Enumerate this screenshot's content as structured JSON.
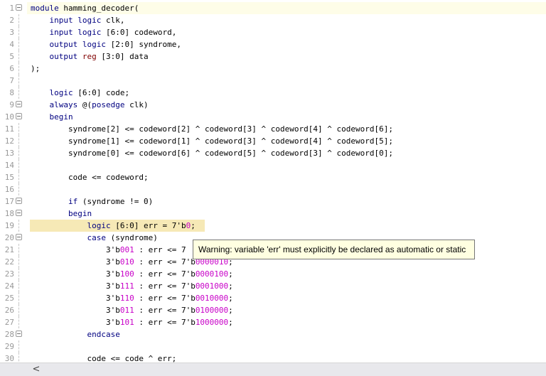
{
  "editor": {
    "lines": [
      {
        "n": "1",
        "fold": true,
        "tokens": [
          [
            "kw",
            "module"
          ],
          [
            "t",
            " hamming_decoder("
          ]
        ]
      },
      {
        "n": "2",
        "fold": false,
        "tokens": [
          [
            "t",
            "    "
          ],
          [
            "kw",
            "input"
          ],
          [
            "t",
            " "
          ],
          [
            "kw",
            "logic"
          ],
          [
            "t",
            " clk,"
          ]
        ]
      },
      {
        "n": "3",
        "fold": false,
        "tokens": [
          [
            "t",
            "    "
          ],
          [
            "kw",
            "input"
          ],
          [
            "t",
            " "
          ],
          [
            "kw",
            "logic"
          ],
          [
            "t",
            " [6:0] codeword,"
          ]
        ]
      },
      {
        "n": "4",
        "fold": false,
        "tokens": [
          [
            "t",
            "    "
          ],
          [
            "kw",
            "output"
          ],
          [
            "t",
            " "
          ],
          [
            "kw",
            "logic"
          ],
          [
            "t",
            " [2:0] syndrome,"
          ]
        ]
      },
      {
        "n": "5",
        "fold": false,
        "tokens": [
          [
            "t",
            "    "
          ],
          [
            "kw",
            "output"
          ],
          [
            "t",
            " "
          ],
          [
            "kw2",
            "reg"
          ],
          [
            "t",
            " [3:0] data"
          ]
        ]
      },
      {
        "n": "6",
        "fold": false,
        "tokens": [
          [
            "t",
            ");"
          ]
        ]
      },
      {
        "n": "7",
        "fold": false,
        "tokens": []
      },
      {
        "n": "8",
        "fold": false,
        "tokens": [
          [
            "t",
            "    "
          ],
          [
            "kw",
            "logic"
          ],
          [
            "t",
            " [6:0] code;"
          ]
        ]
      },
      {
        "n": "9",
        "fold": true,
        "tokens": [
          [
            "t",
            "    "
          ],
          [
            "kw",
            "always"
          ],
          [
            "t",
            " @("
          ],
          [
            "kw",
            "posedge"
          ],
          [
            "t",
            " clk)"
          ]
        ]
      },
      {
        "n": "10",
        "fold": true,
        "tokens": [
          [
            "t",
            "    "
          ],
          [
            "kw",
            "begin"
          ]
        ]
      },
      {
        "n": "11",
        "fold": false,
        "tokens": [
          [
            "t",
            "        syndrome[2] <= codeword[2] ^ codeword[3] ^ codeword[4] ^ codeword[6];"
          ]
        ]
      },
      {
        "n": "12",
        "fold": false,
        "tokens": [
          [
            "t",
            "        syndrome[1] <= codeword[1] ^ codeword[3] ^ codeword[4] ^ codeword[5];"
          ]
        ]
      },
      {
        "n": "13",
        "fold": false,
        "tokens": [
          [
            "t",
            "        syndrome[0] <= codeword[6] ^ codeword[5] ^ codeword[3] ^ codeword[0];"
          ]
        ]
      },
      {
        "n": "14",
        "fold": false,
        "tokens": []
      },
      {
        "n": "15",
        "fold": false,
        "tokens": [
          [
            "t",
            "        code <= codeword;"
          ]
        ]
      },
      {
        "n": "16",
        "fold": false,
        "tokens": []
      },
      {
        "n": "17",
        "fold": true,
        "tokens": [
          [
            "t",
            "        "
          ],
          [
            "kw",
            "if"
          ],
          [
            "t",
            " (syndrome != 0)"
          ]
        ]
      },
      {
        "n": "18",
        "fold": true,
        "tokens": [
          [
            "t",
            "        "
          ],
          [
            "kw",
            "begin"
          ]
        ]
      },
      {
        "n": "19",
        "fold": false,
        "hl": true,
        "tokens": [
          [
            "t",
            "            "
          ],
          [
            "kw",
            "logic"
          ],
          [
            "t",
            " [6:0] err = 7'b"
          ],
          [
            "num",
            "0"
          ],
          [
            "t",
            ";"
          ]
        ]
      },
      {
        "n": "20",
        "fold": true,
        "tokens": [
          [
            "t",
            "            "
          ],
          [
            "kw",
            "case"
          ],
          [
            "t",
            " (syndrome)"
          ]
        ]
      },
      {
        "n": "21",
        "fold": false,
        "tokens": [
          [
            "t",
            "                3'b"
          ],
          [
            "num",
            "001"
          ],
          [
            "t",
            " : err <= 7"
          ]
        ]
      },
      {
        "n": "22",
        "fold": false,
        "tokens": [
          [
            "t",
            "                3'b"
          ],
          [
            "num",
            "010"
          ],
          [
            "t",
            " : err <= 7'b"
          ],
          [
            "num",
            "0000010"
          ],
          [
            "t",
            ";"
          ]
        ]
      },
      {
        "n": "23",
        "fold": false,
        "tokens": [
          [
            "t",
            "                3'b"
          ],
          [
            "num",
            "100"
          ],
          [
            "t",
            " : err <= 7'b"
          ],
          [
            "num",
            "0000100"
          ],
          [
            "t",
            ";"
          ]
        ]
      },
      {
        "n": "24",
        "fold": false,
        "tokens": [
          [
            "t",
            "                3'b"
          ],
          [
            "num",
            "111"
          ],
          [
            "t",
            " : err <= 7'b"
          ],
          [
            "num",
            "0001000"
          ],
          [
            "t",
            ";"
          ]
        ]
      },
      {
        "n": "25",
        "fold": false,
        "tokens": [
          [
            "t",
            "                3'b"
          ],
          [
            "num",
            "110"
          ],
          [
            "t",
            " : err <= 7'b"
          ],
          [
            "num",
            "0010000"
          ],
          [
            "t",
            ";"
          ]
        ]
      },
      {
        "n": "26",
        "fold": false,
        "tokens": [
          [
            "t",
            "                3'b"
          ],
          [
            "num",
            "011"
          ],
          [
            "t",
            " : err <= 7'b"
          ],
          [
            "num",
            "0100000"
          ],
          [
            "t",
            ";"
          ]
        ]
      },
      {
        "n": "27",
        "fold": false,
        "tokens": [
          [
            "t",
            "                3'b"
          ],
          [
            "num",
            "101"
          ],
          [
            "t",
            " : err <= 7'b"
          ],
          [
            "num",
            "1000000"
          ],
          [
            "t",
            ";"
          ]
        ]
      },
      {
        "n": "28",
        "fold": true,
        "tokens": [
          [
            "t",
            "            "
          ],
          [
            "kw",
            "endcase"
          ]
        ]
      },
      {
        "n": "29",
        "fold": false,
        "tokens": []
      },
      {
        "n": "30",
        "fold": false,
        "tokens": [
          [
            "t",
            "            code <= code ^ err;"
          ]
        ]
      }
    ]
  },
  "tooltip": {
    "text": "Warning: variable 'err' must explicitly be declared as automatic or static"
  },
  "scrollbar": {
    "left_arrow": "<"
  },
  "colors": {
    "keyword": "#000080",
    "keyword_reg": "#800000",
    "number": "#c800c8",
    "line_highlight": "#f6e9b6",
    "tooltip_bg": "#ffffe1"
  }
}
